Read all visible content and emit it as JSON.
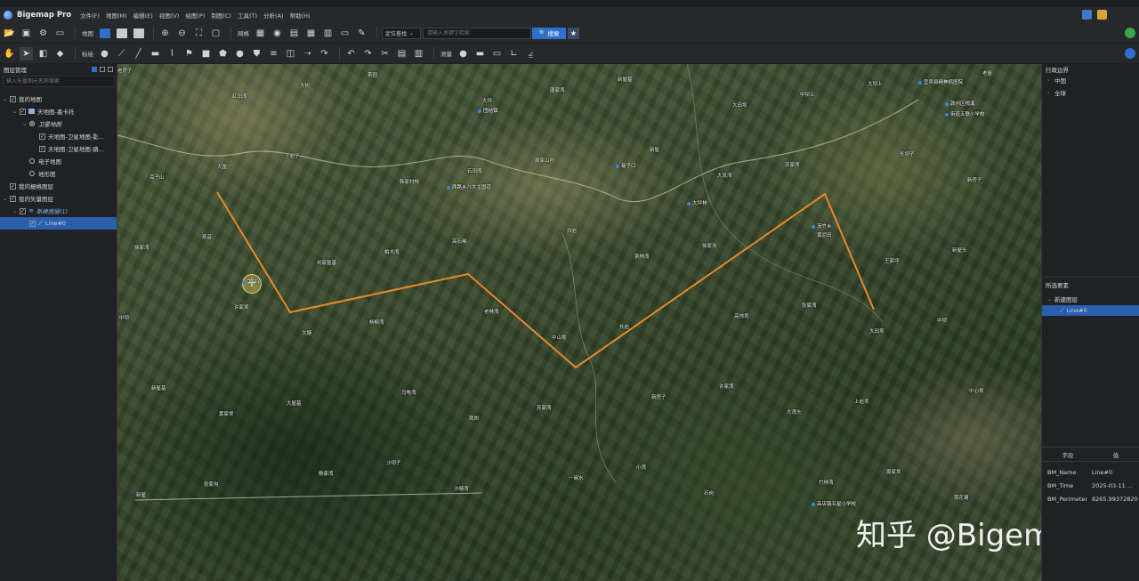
{
  "app": {
    "name": "Bigemap Pro"
  },
  "menu": [
    "文件(F)",
    "地图(M)",
    "编辑(E)",
    "视图(V)",
    "绘图(P)",
    "制图(C)",
    "工具(T)",
    "分析(A)",
    "帮助(H)"
  ],
  "toolbar1": {
    "map_label": "地图",
    "grid_label": "网格",
    "locate_select": "定位查找",
    "search_placeholder": "请输入关键字检索",
    "search_button": "搜索"
  },
  "toolbar2": {
    "annotate_label": "标绘",
    "measure_label": "测量"
  },
  "layer_panel": {
    "title": "图层管理",
    "search_placeholder": "输入矢量图元名称搜索",
    "tree": [
      {
        "label": "我的地图",
        "level": 0,
        "kind": "check",
        "expanded": true
      },
      {
        "label": "天地图-墨卡托",
        "level": 1,
        "kind": "folder",
        "expanded": true
      },
      {
        "label": "卫星地图",
        "level": 2,
        "kind": "radio-on",
        "expanded": true,
        "italic": true
      },
      {
        "label": "天地图-卫星地图-影...",
        "level": 3,
        "kind": "check"
      },
      {
        "label": "天地图-卫星地图-路...",
        "level": 3,
        "kind": "check"
      },
      {
        "label": "电子地图",
        "level": 2,
        "kind": "radio"
      },
      {
        "label": "地形图",
        "level": 2,
        "kind": "radio"
      },
      {
        "label": "我的栅格图层",
        "level": 0,
        "kind": "check"
      },
      {
        "label": "我的矢量图层",
        "level": 0,
        "kind": "check",
        "expanded": true
      },
      {
        "label": "新建图层(1)",
        "level": 1,
        "kind": "layer",
        "expanded": true,
        "italic": true
      },
      {
        "label": "Line#0",
        "level": 2,
        "kind": "line",
        "selected": true
      }
    ]
  },
  "map": {
    "places": [
      "老房子",
      "红田湾",
      "大树",
      "茶园",
      "大坪",
      "唐家湾",
      "新屋基",
      "大田坝",
      "中坝上",
      "大坝上",
      "老屋",
      "耳子山",
      "大堡",
      "下岩子",
      "韩家村林",
      "石田湾",
      "周家山村",
      "新屋",
      "大发湾",
      "苏家湾",
      "长坝子",
      "新房子",
      "徐家湾",
      "观音",
      "刘家屋基",
      "柏木湾",
      "高石梯",
      "白岩",
      "茶林湾",
      "徐家沟",
      "黄泥田",
      "王家坪",
      "新屋头",
      "中坝",
      "许家坝",
      "大塘",
      "杨柳湾",
      "老林湾",
      "中山坝",
      "长岩",
      "高地坝",
      "张家湾",
      "大田坝",
      "中坝",
      "新屋基",
      "黄家坝",
      "大屋基",
      "乌龟湾",
      "窝凼",
      "苏家湾",
      "新房子",
      "许家湾",
      "大湾头",
      "上岩坝",
      "中心坝",
      "新屋",
      "张家沟",
      "杨家湾",
      "沙坝子",
      "沙塘湾",
      "一碗水",
      "小湾",
      "石岗",
      "竹林湾",
      "周家坝",
      "荷花塘"
    ],
    "pois": [
      "团结镇",
      "巷子口",
      "大坪林",
      "茨竹乡",
      "大坪农",
      "宜宾县精神病医院",
      "敦州区枧溪",
      "街道五联小学校",
      "高店镇五星小学校",
      "两路乡八大主国道"
    ],
    "watermark": "知乎 @Bigemap"
  },
  "right_panel": {
    "admin_title": "行政边界",
    "admin_items": [
      "中国",
      "全球"
    ],
    "features_title": "所选要素",
    "feature_layer": "新建图层",
    "feature_item": "Line#0",
    "attr_headers": [
      "字段",
      "值"
    ],
    "attrs": [
      {
        "field": "BM_Name",
        "value": "Line#0"
      },
      {
        "field": "BM_Time",
        "value": "2025-03-11 ..."
      },
      {
        "field": "BM_Perimeter",
        "value": "8265.99372820"
      }
    ]
  },
  "colors": {
    "line": "#e8892b",
    "accent": "#2f6fce",
    "panel": "#202124"
  }
}
